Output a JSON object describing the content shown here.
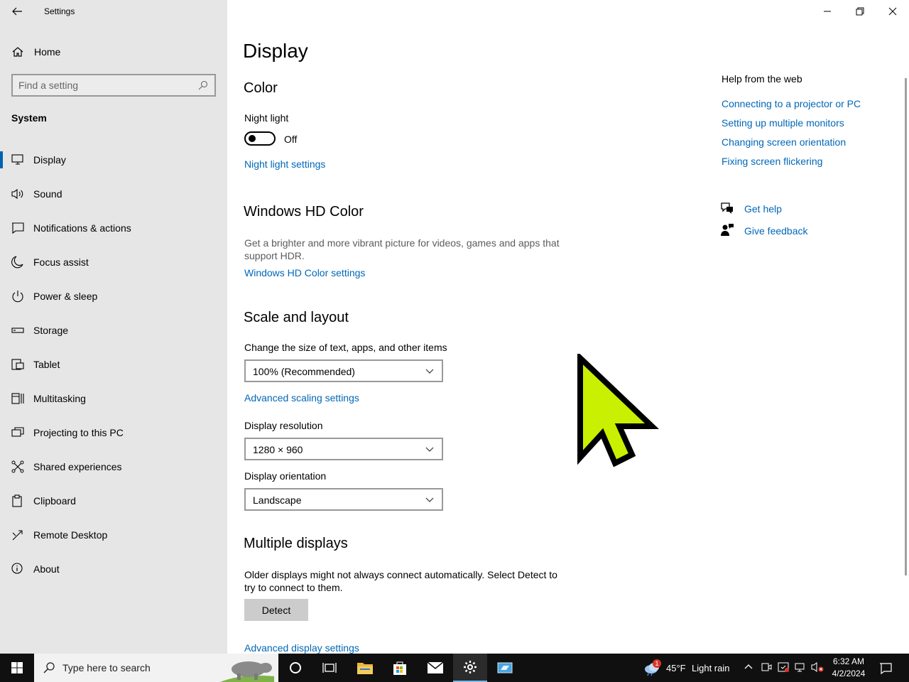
{
  "window": {
    "title": "Settings"
  },
  "sidebar": {
    "home_label": "Home",
    "search_placeholder": "Find a setting",
    "section": "System",
    "items": [
      {
        "label": "Display",
        "icon": "monitor-icon",
        "active": true
      },
      {
        "label": "Sound",
        "icon": "speaker-icon"
      },
      {
        "label": "Notifications & actions",
        "icon": "notification-icon"
      },
      {
        "label": "Focus assist",
        "icon": "moon-icon"
      },
      {
        "label": "Power & sleep",
        "icon": "power-icon"
      },
      {
        "label": "Storage",
        "icon": "storage-icon"
      },
      {
        "label": "Tablet",
        "icon": "tablet-icon"
      },
      {
        "label": "Multitasking",
        "icon": "multitasking-icon"
      },
      {
        "label": "Projecting to this PC",
        "icon": "projecting-icon"
      },
      {
        "label": "Shared experiences",
        "icon": "shared-icon"
      },
      {
        "label": "Clipboard",
        "icon": "clipboard-icon"
      },
      {
        "label": "Remote Desktop",
        "icon": "remote-desktop-icon"
      },
      {
        "label": "About",
        "icon": "info-icon"
      }
    ]
  },
  "main": {
    "title": "Display",
    "color": {
      "heading": "Color",
      "night_light_label": "Night light",
      "night_light_state": "Off",
      "night_light_settings": "Night light settings"
    },
    "hdr": {
      "heading": "Windows HD Color",
      "description": "Get a brighter and more vibrant picture for videos, games and apps that support HDR.",
      "settings_link": "Windows HD Color settings"
    },
    "scale": {
      "heading": "Scale and layout",
      "size_label": "Change the size of text, apps, and other items",
      "size_value": "100% (Recommended)",
      "advanced_scaling": "Advanced scaling settings",
      "resolution_label": "Display resolution",
      "resolution_value": "1280 × 960",
      "orientation_label": "Display orientation",
      "orientation_value": "Landscape"
    },
    "multiple": {
      "heading": "Multiple displays",
      "description": "Older displays might not always connect automatically. Select Detect to try to connect to them.",
      "detect_label": "Detect",
      "advanced_display": "Advanced display settings"
    }
  },
  "help": {
    "title": "Help from the web",
    "links": [
      "Connecting to a projector or PC",
      "Setting up multiple monitors",
      "Changing screen orientation",
      "Fixing screen flickering"
    ],
    "get_help": "Get help",
    "give_feedback": "Give feedback"
  },
  "taskbar": {
    "search_placeholder": "Type here to search",
    "weather_temp": "45°F",
    "weather_text": "Light rain",
    "weather_badge": "1",
    "time": "6:32 AM",
    "date": "4/2/2024"
  },
  "colors": {
    "accent": "#0063b1",
    "link": "#0067b8",
    "sidebar_bg": "#e6e6e6",
    "cursor_fill": "#c8f000"
  }
}
